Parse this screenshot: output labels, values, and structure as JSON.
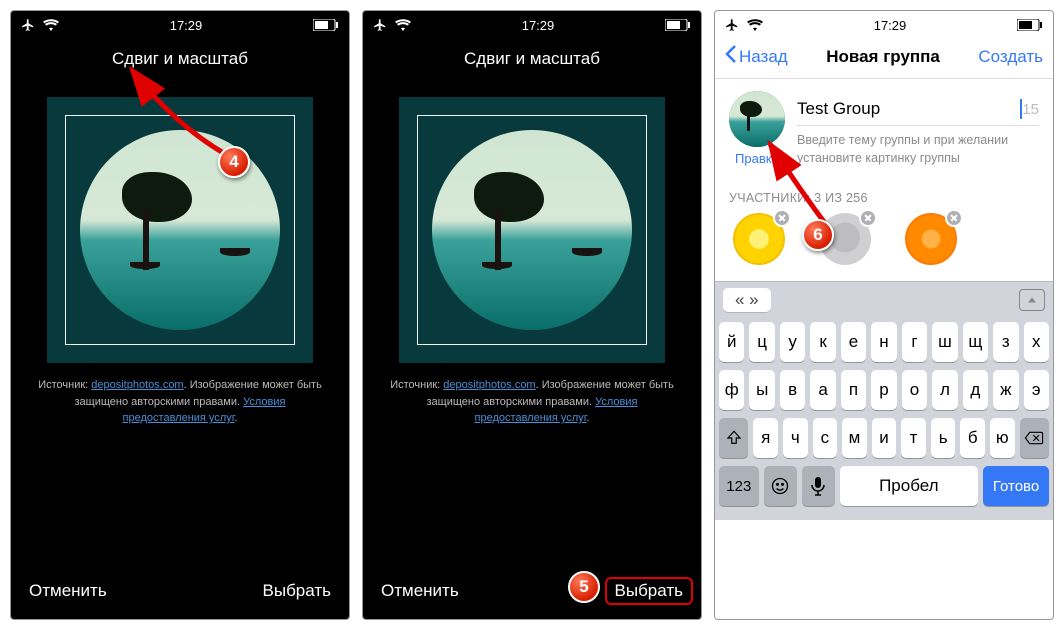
{
  "status": {
    "time": "17:29"
  },
  "crop": {
    "title": "Сдвиг и масштаб",
    "source_prefix": "Источник: ",
    "source_link": "depositphotos.com",
    "source_suffix": ". Изображение может быть защищено авторскими правами. ",
    "terms_link": "Условия предоставления услуг",
    "cancel": "Отменить",
    "choose": "Выбрать"
  },
  "group": {
    "nav_back": "Назад",
    "nav_title": "Новая группа",
    "nav_create": "Создать",
    "edit": "Правка",
    "name_value": "Test Group",
    "char_remaining": "15",
    "hint": "Введите тему группы и при желании установите картинку группы",
    "participants_label": "УЧАСТНИКИ: 3 ИЗ 256"
  },
  "keyboard": {
    "quicktype_arrows": "«   »",
    "row1": [
      "й",
      "ц",
      "у",
      "к",
      "е",
      "н",
      "г",
      "ш",
      "щ",
      "з",
      "х"
    ],
    "row2": [
      "ф",
      "ы",
      "в",
      "а",
      "п",
      "р",
      "о",
      "л",
      "д",
      "ж",
      "э"
    ],
    "row3": [
      "я",
      "ч",
      "с",
      "м",
      "и",
      "т",
      "ь",
      "б",
      "ю"
    ],
    "k123": "123",
    "space": "Пробел",
    "done": "Готово"
  },
  "badges": {
    "b4": "4",
    "b5": "5",
    "b6": "6"
  }
}
